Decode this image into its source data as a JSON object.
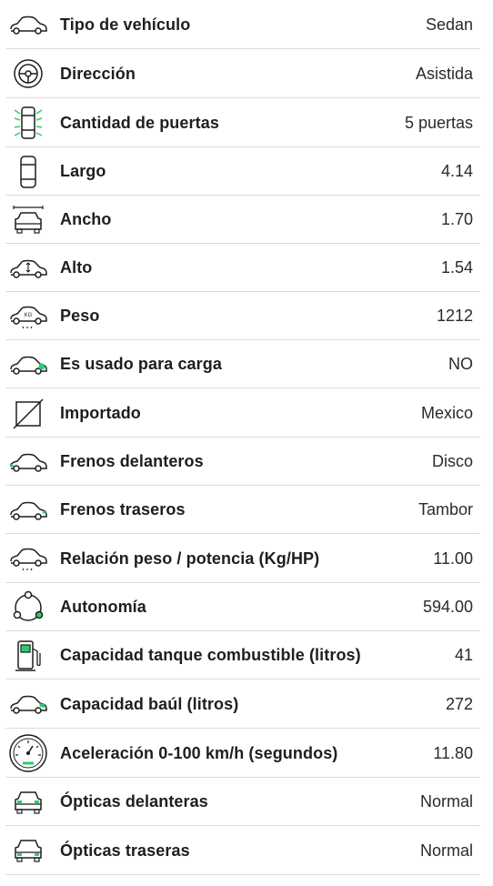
{
  "colors": {
    "accent": "#2ecc71",
    "text": "#1e1e1e",
    "divider": "#dcdcdc"
  },
  "specs": [
    {
      "label": "Tipo de vehículo",
      "value": "Sedan",
      "icon": "car-side-icon"
    },
    {
      "label": "Dirección",
      "value": "Asistida",
      "icon": "steering-wheel-icon"
    },
    {
      "label": "Cantidad de puertas",
      "value": "5 puertas",
      "icon": "car-doors-icon"
    },
    {
      "label": "Largo",
      "value": "4.14",
      "icon": "car-length-icon"
    },
    {
      "label": "Ancho",
      "value": "1.70",
      "icon": "car-width-icon"
    },
    {
      "label": "Alto",
      "value": "1.54",
      "icon": "car-height-icon"
    },
    {
      "label": "Peso",
      "value": "1212",
      "icon": "car-weight-icon"
    },
    {
      "label": "Es usado para carga",
      "value": "NO",
      "icon": "car-cargo-icon"
    },
    {
      "label": "Importado",
      "value": "Mexico",
      "icon": "imported-icon"
    },
    {
      "label": "Frenos delanteros",
      "value": "Disco",
      "icon": "front-brakes-icon"
    },
    {
      "label": "Frenos traseros",
      "value": "Tambor",
      "icon": "rear-brakes-icon"
    },
    {
      "label": "Relación peso / potencia (Kg/HP)",
      "value": "11.00",
      "icon": "power-weight-icon"
    },
    {
      "label": "Autonomía",
      "value": "594.00",
      "icon": "autonomy-icon"
    },
    {
      "label": "Capacidad tanque combustible (litros)",
      "value": "41",
      "icon": "fuel-pump-icon"
    },
    {
      "label": "Capacidad baúl (litros)",
      "value": "272",
      "icon": "trunk-icon"
    },
    {
      "label": "Aceleración 0-100 km/h (segundos)",
      "value": "11.80",
      "icon": "speedometer-icon"
    },
    {
      "label": "Ópticas delanteras",
      "value": "Normal",
      "icon": "front-lights-icon"
    },
    {
      "label": "Ópticas traseras",
      "value": "Normal",
      "icon": "rear-lights-icon"
    }
  ]
}
